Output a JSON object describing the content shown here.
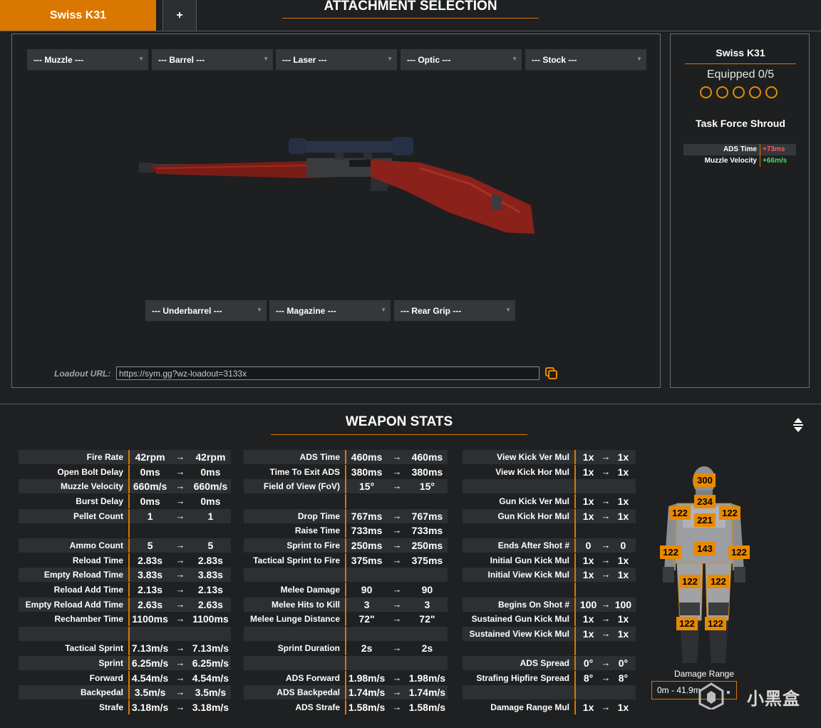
{
  "tabs": {
    "active": "Swiss K31",
    "add": "+"
  },
  "attachment": {
    "title": "ATTACHMENT SELECTION",
    "dropdowns_top": [
      "--- Muzzle ---",
      "--- Barrel ---",
      "--- Laser ---",
      "--- Optic ---",
      "--- Stock ---"
    ],
    "dropdowns_bottom": [
      "--- Underbarrel ---",
      "--- Magazine ---",
      "--- Rear Grip ---"
    ],
    "loadout_label": "Loadout URL:",
    "loadout_url": "https://sym.gg?wz-loadout=3133x"
  },
  "side": {
    "weapon_name": "Swiss K31",
    "equipped": "Equipped 0/5",
    "attachment_slots": 5,
    "blueprint": "Task Force Shroud",
    "mods": [
      {
        "label": "ADS Time",
        "value": "+73ms",
        "color": "#ff5a5a"
      },
      {
        "label": "Muzzle Velocity",
        "value": "+66m/s",
        "color": "#4cd964"
      }
    ]
  },
  "stats": {
    "title": "WEAPON STATS",
    "col1": [
      {
        "label": "Fire Rate",
        "a": "42rpm",
        "b": "42rpm"
      },
      {
        "label": "Open Bolt Delay",
        "a": "0ms",
        "b": "0ms"
      },
      {
        "label": "Muzzle Velocity",
        "a": "660m/s",
        "b": "660m/s"
      },
      {
        "label": "Burst Delay",
        "a": "0ms",
        "b": "0ms"
      },
      {
        "label": "Pellet Count",
        "a": "1",
        "b": "1"
      },
      {
        "label": "",
        "a": "",
        "b": ""
      },
      {
        "label": "Ammo Count",
        "a": "5",
        "b": "5"
      },
      {
        "label": "Reload Time",
        "a": "2.83s",
        "b": "2.83s"
      },
      {
        "label": "Empty Reload Time",
        "a": "3.83s",
        "b": "3.83s"
      },
      {
        "label": "Reload Add Time",
        "a": "2.13s",
        "b": "2.13s"
      },
      {
        "label": "Empty Reload Add Time",
        "a": "2.63s",
        "b": "2.63s"
      },
      {
        "label": "Rechamber Time",
        "a": "1100ms",
        "b": "1100ms"
      },
      {
        "label": "",
        "a": "",
        "b": ""
      },
      {
        "label": "Tactical Sprint",
        "a": "7.13m/s",
        "b": "7.13m/s"
      },
      {
        "label": "Sprint",
        "a": "6.25m/s",
        "b": "6.25m/s"
      },
      {
        "label": "Forward",
        "a": "4.54m/s",
        "b": "4.54m/s"
      },
      {
        "label": "Backpedal",
        "a": "3.5m/s",
        "b": "3.5m/s"
      },
      {
        "label": "Strafe",
        "a": "3.18m/s",
        "b": "3.18m/s"
      }
    ],
    "col2": [
      {
        "label": "ADS Time",
        "a": "460ms",
        "b": "460ms"
      },
      {
        "label": "Time To Exit ADS",
        "a": "380ms",
        "b": "380ms"
      },
      {
        "label": "Field of View (FoV)",
        "a": "15°",
        "b": "15°"
      },
      {
        "label": "",
        "a": "",
        "b": ""
      },
      {
        "label": "Drop Time",
        "a": "767ms",
        "b": "767ms"
      },
      {
        "label": "Raise Time",
        "a": "733ms",
        "b": "733ms"
      },
      {
        "label": "Sprint to Fire",
        "a": "250ms",
        "b": "250ms"
      },
      {
        "label": "Tactical Sprint to Fire",
        "a": "375ms",
        "b": "375ms"
      },
      {
        "label": "",
        "a": "",
        "b": ""
      },
      {
        "label": "Melee Damage",
        "a": "90",
        "b": "90"
      },
      {
        "label": "Melee Hits to Kill",
        "a": "3",
        "b": "3"
      },
      {
        "label": "Melee Lunge Distance",
        "a": "72\"",
        "b": "72\""
      },
      {
        "label": "",
        "a": "",
        "b": ""
      },
      {
        "label": "Sprint Duration",
        "a": "2s",
        "b": "2s"
      },
      {
        "label": "",
        "a": "",
        "b": ""
      },
      {
        "label": "ADS Forward",
        "a": "1.98m/s",
        "b": "1.98m/s"
      },
      {
        "label": "ADS Backpedal",
        "a": "1.74m/s",
        "b": "1.74m/s"
      },
      {
        "label": "ADS Strafe",
        "a": "1.58m/s",
        "b": "1.58m/s"
      }
    ],
    "col3": [
      {
        "label": "View Kick Ver Mul",
        "a": "1x",
        "b": "1x"
      },
      {
        "label": "View Kick Hor Mul",
        "a": "1x",
        "b": "1x"
      },
      {
        "label": "",
        "a": "",
        "b": ""
      },
      {
        "label": "Gun Kick Ver Mul",
        "a": "1x",
        "b": "1x"
      },
      {
        "label": "Gun Kick Hor Mul",
        "a": "1x",
        "b": "1x"
      },
      {
        "label": "",
        "a": "",
        "b": ""
      },
      {
        "label": "Ends After Shot #",
        "a": "0",
        "b": "0"
      },
      {
        "label": "Initial Gun Kick Mul",
        "a": "1x",
        "b": "1x"
      },
      {
        "label": "Initial View Kick Mul",
        "a": "1x",
        "b": "1x"
      },
      {
        "label": "",
        "a": "",
        "b": ""
      },
      {
        "label": "Begins On Shot #",
        "a": "100",
        "b": "100"
      },
      {
        "label": "Sustained Gun Kick Mul",
        "a": "1x",
        "b": "1x"
      },
      {
        "label": "Sustained View Kick Mul",
        "a": "1x",
        "b": "1x"
      },
      {
        "label": "",
        "a": "",
        "b": ""
      },
      {
        "label": "ADS Spread",
        "a": "0°",
        "b": "0°"
      },
      {
        "label": "Strafing Hipfire Spread",
        "a": "8°",
        "b": "8°"
      },
      {
        "label": "",
        "a": "",
        "b": ""
      },
      {
        "label": "Damage Range Mul",
        "a": "1x",
        "b": "1x"
      }
    ],
    "arrow": "→"
  },
  "damage": {
    "head": "300",
    "neck": "234",
    "chest": "221",
    "shoulder_left": "122",
    "shoulder_right": "122",
    "stomach": "143",
    "arm_left": "122",
    "arm_right": "122",
    "thigh_left": "122",
    "thigh_right": "122",
    "shin_left": "122",
    "shin_right": "122",
    "range_label": "Damage Range",
    "range_value": "0m - 41.9m"
  },
  "watermark": "小黑盒",
  "colors": {
    "accent": "#d97700",
    "negative": "#ff5a5a",
    "positive": "#4cd964"
  }
}
